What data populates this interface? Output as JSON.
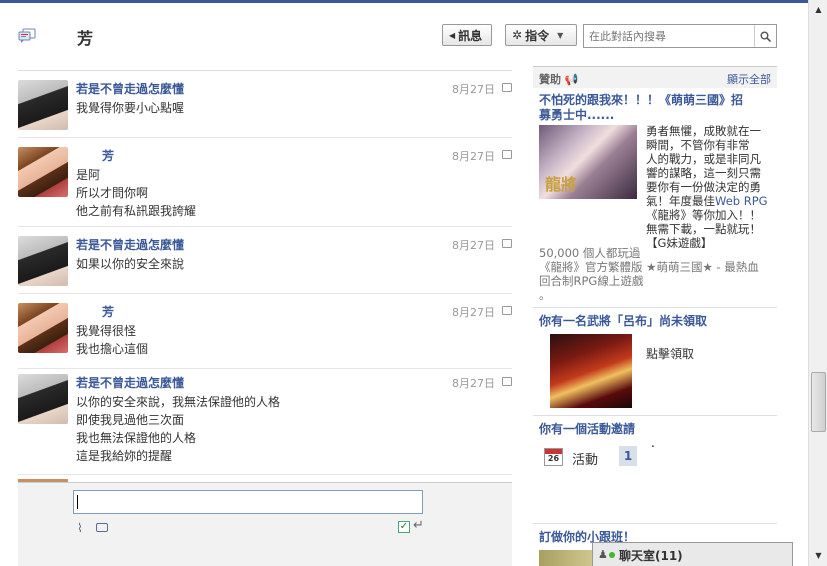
{
  "header": {
    "title": "芳",
    "messages_button": "訊息",
    "actions_button": "指令",
    "search_placeholder": "在此對話內搜尋"
  },
  "messages": [
    {
      "sender": "若是不曾走過怎麼懂",
      "date": "8月27日",
      "lines": [
        "我覺得你要小心點喔"
      ],
      "avatar": "boy"
    },
    {
      "sender": "芳",
      "date": "8月27日",
      "lines": [
        "是阿",
        "所以才問你啊",
        "他之前有私訊跟我誇耀"
      ],
      "avatar": "girl"
    },
    {
      "sender": "若是不曾走過怎麼懂",
      "date": "8月27日",
      "lines": [
        "如果以你的安全來說"
      ],
      "avatar": "boy"
    },
    {
      "sender": "芳",
      "date": "8月27日",
      "lines": [
        "我覺得很怪",
        "我也擔心這個"
      ],
      "avatar": "girl"
    },
    {
      "sender": "若是不曾走過怎麼懂",
      "date": "8月27日",
      "lines": [
        "以你的安全來說，我無法保證他的人格",
        "即使我見過他三次面",
        "我也無法保證他的人格",
        "這是我給妳的提醒"
      ],
      "avatar": "boy"
    }
  ],
  "sponsored": {
    "header": "贊助",
    "show_all": "顯示全部",
    "ad1": {
      "title_1": "不怕死的跟我來！！！《萌萌三國》招",
      "title_2": "募勇士中......",
      "image_text": "龍將",
      "body": [
        "勇者無懼，成敗就在一",
        "瞬間，不管你有非常",
        "人的戰力，或是非同凡",
        "響的謀略，這一刻只需",
        "要你有一份做決定的勇",
        "氣！年度最佳",
        "《龍將》等你加入！！",
        "無需下載，一點就玩！",
        "【G妹遊戲】"
      ],
      "body_highlight": "Web RPG",
      "meta": [
        "50,000 個人都玩過",
        "《龍將》官方繁體版 ★萌萌三國★ - 最熱血",
        "回合制RPG線上遊戲",
        "。"
      ]
    },
    "ad2": {
      "title": "你有一名武將「呂布」尚未領取",
      "cta": "點擊領取"
    },
    "invite": {
      "title": "你有一個活動邀請",
      "calendar_day": "26",
      "label": "活動",
      "count": "1",
      "dot": "."
    },
    "ad3_title": "訂做你的小跟班！"
  },
  "chat": {
    "label": "聊天室(11)"
  }
}
